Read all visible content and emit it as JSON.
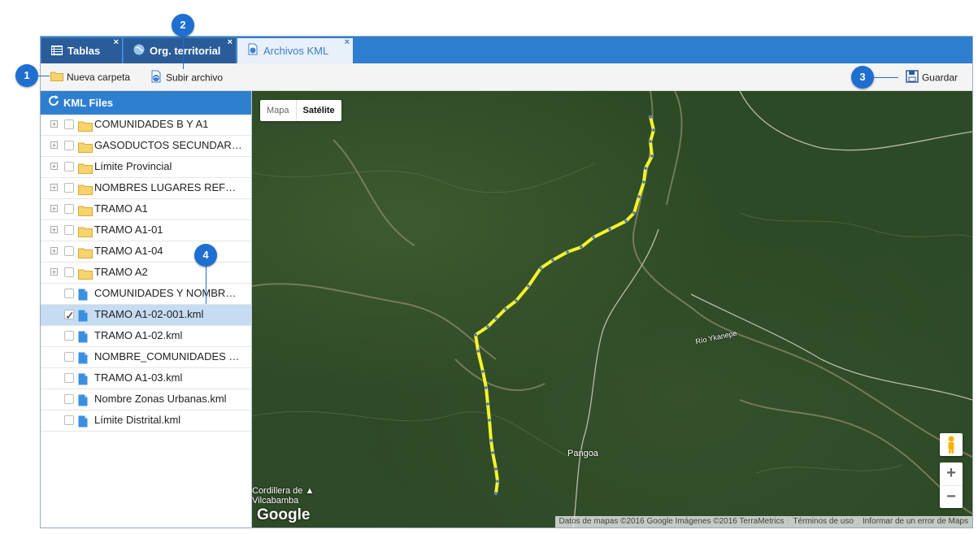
{
  "tabs": [
    {
      "label": "Tablas",
      "icon": "table-icon",
      "close": "×"
    },
    {
      "label": "Org. territorial",
      "icon": "globe-icon",
      "close": "×"
    },
    {
      "label": "Archivos KML",
      "icon": "kml-file-icon",
      "close": "×"
    }
  ],
  "toolbar": {
    "new_folder": "Nueva carpeta",
    "upload": "Subir archivo",
    "save": "Guardar"
  },
  "panel": {
    "title": "KML Files",
    "items": [
      {
        "label": "COMUNIDADES B Y A1",
        "type": "folder",
        "expandable": true,
        "checked": false,
        "selected": false
      },
      {
        "label": "GASODUCTOS SECUNDAR…",
        "type": "folder",
        "expandable": true,
        "checked": false,
        "selected": false
      },
      {
        "label": "Límite Provincial",
        "type": "folder",
        "expandable": true,
        "checked": false,
        "selected": false
      },
      {
        "label": "NOMBRES LUGARES REF…",
        "type": "folder",
        "expandable": true,
        "checked": false,
        "selected": false
      },
      {
        "label": "TRAMO A1",
        "type": "folder",
        "expandable": true,
        "checked": false,
        "selected": false
      },
      {
        "label": "TRAMO A1-01",
        "type": "folder",
        "expandable": true,
        "checked": false,
        "selected": false
      },
      {
        "label": "TRAMO A1-04",
        "type": "folder",
        "expandable": true,
        "checked": false,
        "selected": false
      },
      {
        "label": "TRAMO A2",
        "type": "folder",
        "expandable": true,
        "checked": false,
        "selected": false
      },
      {
        "label": "COMUNIDADES Y NOMBR…",
        "type": "file",
        "expandable": false,
        "checked": false,
        "selected": false
      },
      {
        "label": "TRAMO A1-02-001.kml",
        "type": "file",
        "expandable": false,
        "checked": true,
        "selected": true
      },
      {
        "label": "TRAMO A1-02.kml",
        "type": "file",
        "expandable": false,
        "checked": false,
        "selected": false
      },
      {
        "label": "NOMBRE_COMUNIDADES …",
        "type": "file",
        "expandable": false,
        "checked": false,
        "selected": false
      },
      {
        "label": "TRAMO A1-03.kml",
        "type": "file",
        "expandable": false,
        "checked": false,
        "selected": false
      },
      {
        "label": "Nombre Zonas Urbanas.kml",
        "type": "file",
        "expandable": false,
        "checked": false,
        "selected": false
      },
      {
        "label": "Límite Distrital.kml",
        "type": "file",
        "expandable": false,
        "checked": false,
        "selected": false
      }
    ]
  },
  "map": {
    "type_map": "Mapa",
    "type_satellite": "Satélite",
    "zoom_in": "+",
    "zoom_out": "−",
    "logo": "Google",
    "place_pangoa": "Pangoa",
    "place_cordillera_1": "Cordillera de",
    "place_cordillera_2": "Vilcabamba",
    "river_label": "Río Ykanepe",
    "attribution": "Datos de mapas ©2016 Google Imágenes ©2016 TerraMetrics",
    "terms": "Términos de uso",
    "report": "Informar de un error de Maps",
    "route_color": "#f4f42a",
    "route_vertex_color": "#4a6fd0"
  },
  "callouts": [
    "1",
    "2",
    "3",
    "4"
  ],
  "colors": {
    "accent": "#2f7fd0",
    "tab_dark": "#2a5c9a",
    "callout": "#1e6fd0",
    "selection": "#c5dcf2",
    "folder": "#f7d36b",
    "file": "#3b8fe0"
  }
}
